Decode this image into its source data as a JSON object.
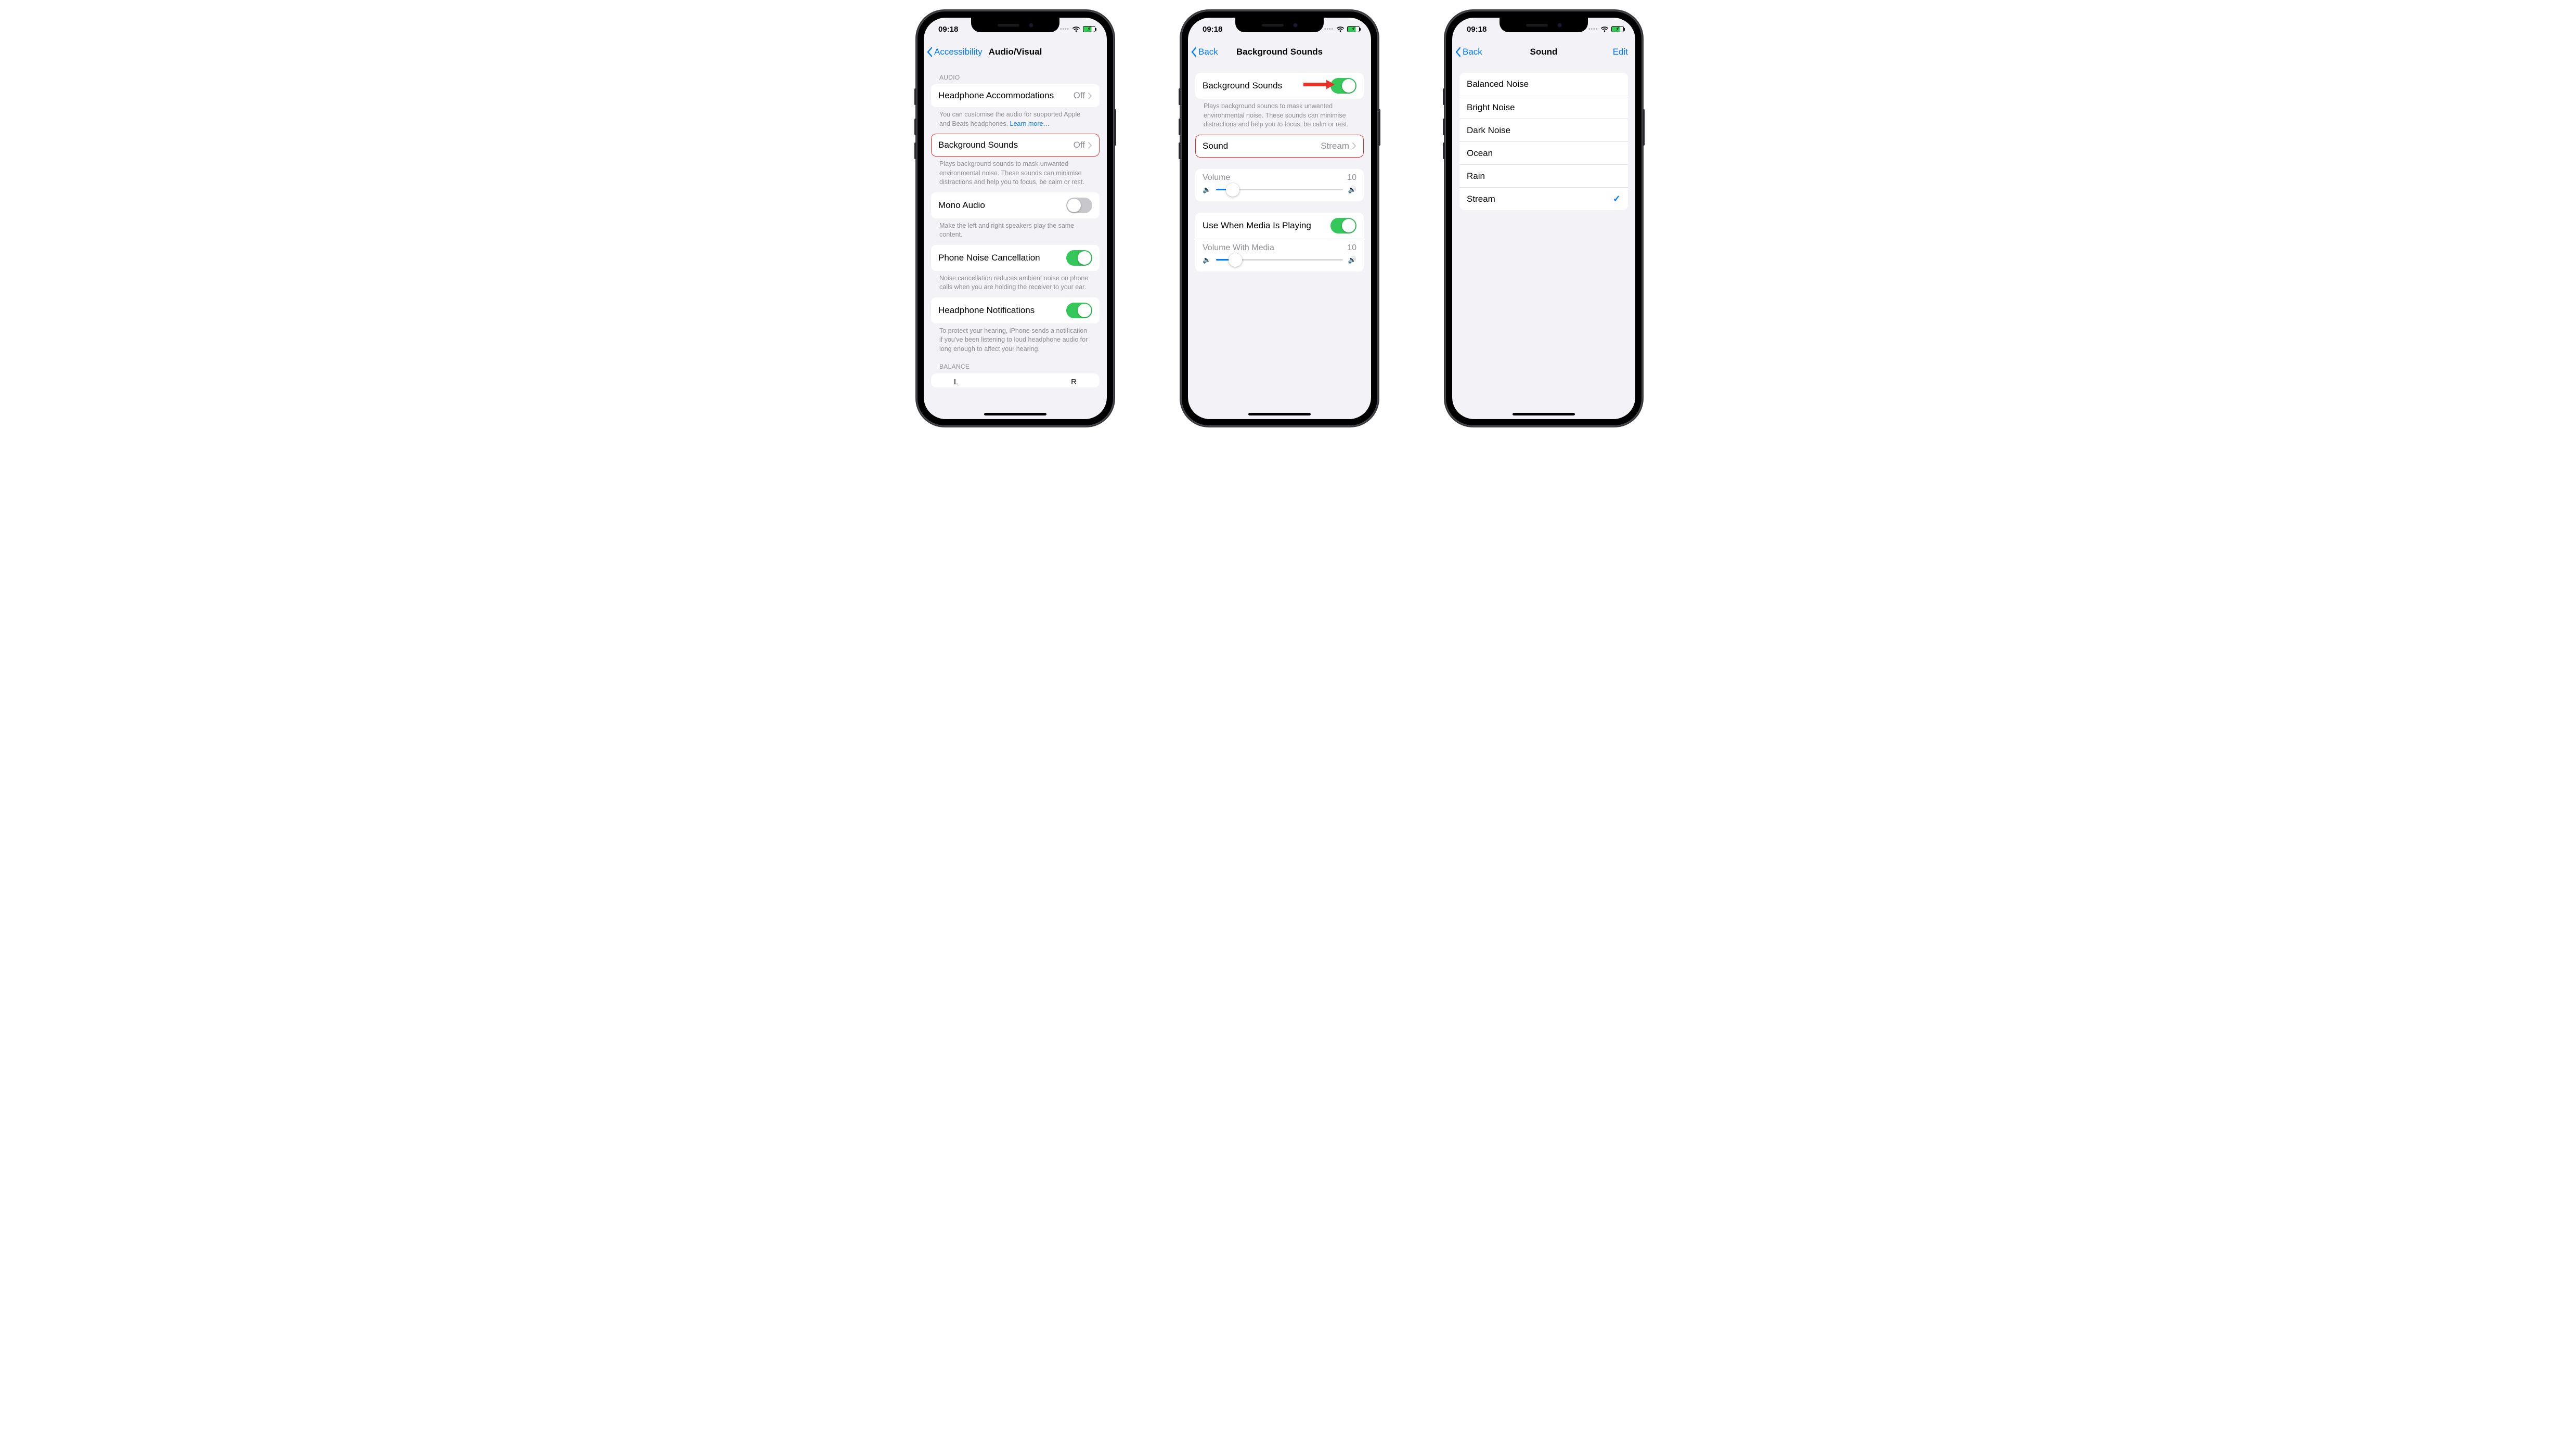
{
  "status": {
    "time": "09:18"
  },
  "phone1": {
    "back": "Accessibility",
    "title": "Audio/Visual",
    "audio_header": "AUDIO",
    "headphone_accom": {
      "label": "Headphone Accommodations",
      "value": "Off"
    },
    "headphone_footer_pre": "You can customise the audio for supported Apple and Beats headphones. ",
    "headphone_footer_link": "Learn more…",
    "bg_sounds": {
      "label": "Background Sounds",
      "value": "Off"
    },
    "bg_sounds_footer": "Plays background sounds to mask unwanted environmental noise. These sounds can minimise distractions and help you to focus, be calm or rest.",
    "mono_audio": {
      "label": "Mono Audio",
      "on": false
    },
    "mono_footer": "Make the left and right speakers play the same content.",
    "noise_cancel": {
      "label": "Phone Noise Cancellation",
      "on": true
    },
    "noise_footer": "Noise cancellation reduces ambient noise on phone calls when you are holding the receiver to your ear.",
    "headphone_notif": {
      "label": "Headphone Notifications",
      "on": true
    },
    "headphone_notif_footer": "To protect your hearing, iPhone sends a notification if you've been listening to loud headphone audio for long enough to affect your hearing.",
    "balance_header": "BALANCE",
    "balance_left": "L",
    "balance_right": "R"
  },
  "phone2": {
    "back": "Back",
    "title": "Background Sounds",
    "bg_toggle": {
      "label": "Background Sounds",
      "on": true
    },
    "bg_footer": "Plays background sounds to mask unwanted environmental noise. These sounds can minimise distractions and help you to focus, be calm or rest.",
    "sound_row": {
      "label": "Sound",
      "value": "Stream"
    },
    "volume": {
      "label": "Volume",
      "value": "10",
      "percent": 13
    },
    "media_toggle": {
      "label": "Use When Media Is Playing",
      "on": true
    },
    "media_volume": {
      "label": "Volume With Media",
      "value": "10",
      "percent": 15
    }
  },
  "phone3": {
    "back": "Back",
    "title": "Sound",
    "edit": "Edit",
    "options": [
      {
        "label": "Balanced Noise",
        "selected": false
      },
      {
        "label": "Bright Noise",
        "selected": false
      },
      {
        "label": "Dark Noise",
        "selected": false
      },
      {
        "label": "Ocean",
        "selected": false
      },
      {
        "label": "Rain",
        "selected": false
      },
      {
        "label": "Stream",
        "selected": true
      }
    ]
  }
}
